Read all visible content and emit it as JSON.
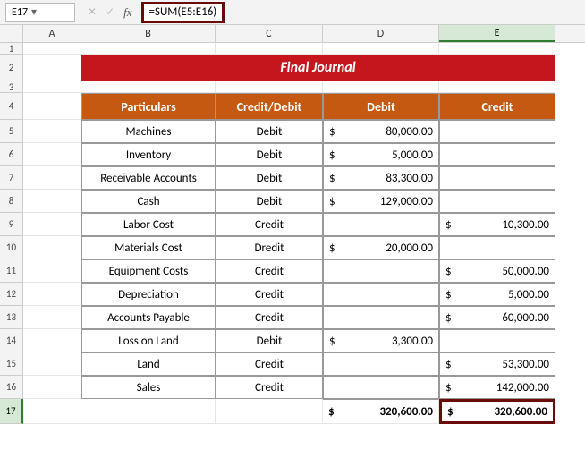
{
  "namebox": "E17",
  "formula": "=SUM(E5:E16)",
  "columns": [
    "A",
    "B",
    "C",
    "D",
    "E"
  ],
  "title": "Final Journal",
  "headers": {
    "particulars": "Particulars",
    "cd": "Credit/Debit",
    "debit": "Debit",
    "credit": "Credit"
  },
  "fx_label": "fx",
  "rows": [
    {
      "n": "5",
      "p": "Machines",
      "cd": "Debit",
      "d": "80,000.00",
      "c": ""
    },
    {
      "n": "6",
      "p": "Inventory",
      "cd": "Debit",
      "d": "5,000.00",
      "c": ""
    },
    {
      "n": "7",
      "p": "Receivable Accounts",
      "cd": "Debit",
      "d": "83,300.00",
      "c": ""
    },
    {
      "n": "8",
      "p": "Cash",
      "cd": "Debit",
      "d": "129,000.00",
      "c": ""
    },
    {
      "n": "9",
      "p": "Labor Cost",
      "cd": "Credit",
      "d": "",
      "c": "10,300.00"
    },
    {
      "n": "10",
      "p": "Materials Cost",
      "cd": "Dredit",
      "d": "20,000.00",
      "c": ""
    },
    {
      "n": "11",
      "p": "Equipment Costs",
      "cd": "Credit",
      "d": "",
      "c": "50,000.00"
    },
    {
      "n": "12",
      "p": "Depreciation",
      "cd": "Credit",
      "d": "",
      "c": "5,000.00"
    },
    {
      "n": "13",
      "p": "Accounts Payable",
      "cd": "Credit",
      "d": "",
      "c": "60,000.00"
    },
    {
      "n": "14",
      "p": "Loss on Land",
      "cd": "Debit",
      "d": "3,300.00",
      "c": ""
    },
    {
      "n": "15",
      "p": "Land",
      "cd": "Credit",
      "d": "",
      "c": "53,300.00"
    },
    {
      "n": "16",
      "p": "Sales",
      "cd": "Credit",
      "d": "",
      "c": "142,000.00"
    }
  ],
  "totals": {
    "row": "17",
    "debit": "320,600.00",
    "credit": "320,600.00"
  },
  "currency": "$",
  "chart_data": {
    "type": "table",
    "title": "Final Journal",
    "columns": [
      "Particulars",
      "Credit/Debit",
      "Debit",
      "Credit"
    ],
    "rows": [
      [
        "Machines",
        "Debit",
        80000.0,
        null
      ],
      [
        "Inventory",
        "Debit",
        5000.0,
        null
      ],
      [
        "Receivable Accounts",
        "Debit",
        83300.0,
        null
      ],
      [
        "Cash",
        "Debit",
        129000.0,
        null
      ],
      [
        "Labor Cost",
        "Credit",
        null,
        10300.0
      ],
      [
        "Materials Cost",
        "Dredit",
        20000.0,
        null
      ],
      [
        "Equipment Costs",
        "Credit",
        null,
        50000.0
      ],
      [
        "Depreciation",
        "Credit",
        null,
        5000.0
      ],
      [
        "Accounts Payable",
        "Credit",
        null,
        60000.0
      ],
      [
        "Loss on Land",
        "Debit",
        3300.0,
        null
      ],
      [
        "Land",
        "Credit",
        null,
        53300.0
      ],
      [
        "Sales",
        "Credit",
        null,
        142000.0
      ]
    ],
    "totals": {
      "debit": 320600.0,
      "credit": 320600.0
    }
  }
}
